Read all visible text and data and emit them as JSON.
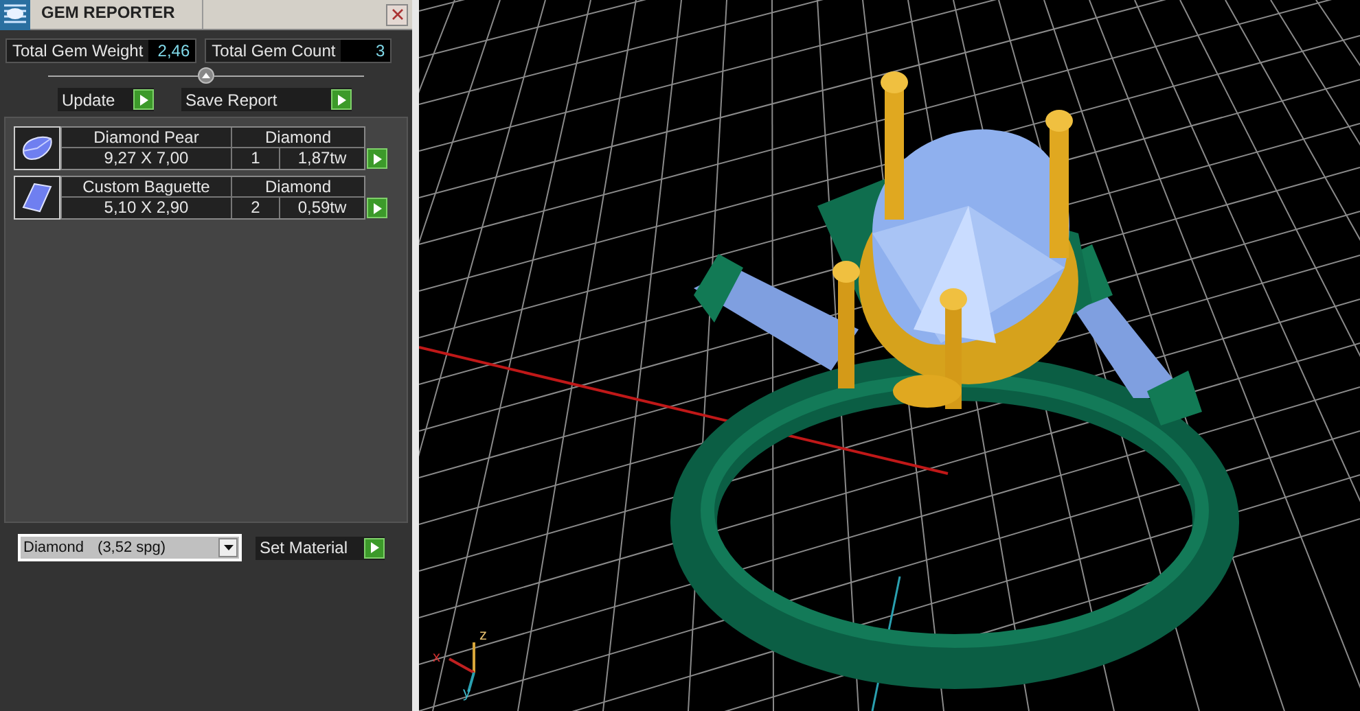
{
  "panel": {
    "title": "GEM REPORTER",
    "stats": [
      {
        "label": "Total Gem Weight",
        "value": "2,46"
      },
      {
        "label": "Total Gem Count",
        "value": "3"
      }
    ],
    "buttons": [
      {
        "label": "Update"
      },
      {
        "label": "Save Report"
      }
    ],
    "gems": [
      {
        "kind": "pear",
        "name": "Diamond Pear",
        "material": "Diamond",
        "size": "9,27 X 7,00",
        "count": "1",
        "weight": "1,87tw"
      },
      {
        "kind": "baguette",
        "name": "Custom Baguette",
        "material": "Diamond",
        "size": "5,10 X 2,90",
        "count": "2",
        "weight": "0,59tw"
      }
    ],
    "material_select": {
      "material": "Diamond",
      "density": "(3,52 spg)"
    },
    "set_button": "Set Material"
  },
  "viewport": {
    "axes": {
      "x": "x",
      "y": "y",
      "z": "z"
    }
  }
}
